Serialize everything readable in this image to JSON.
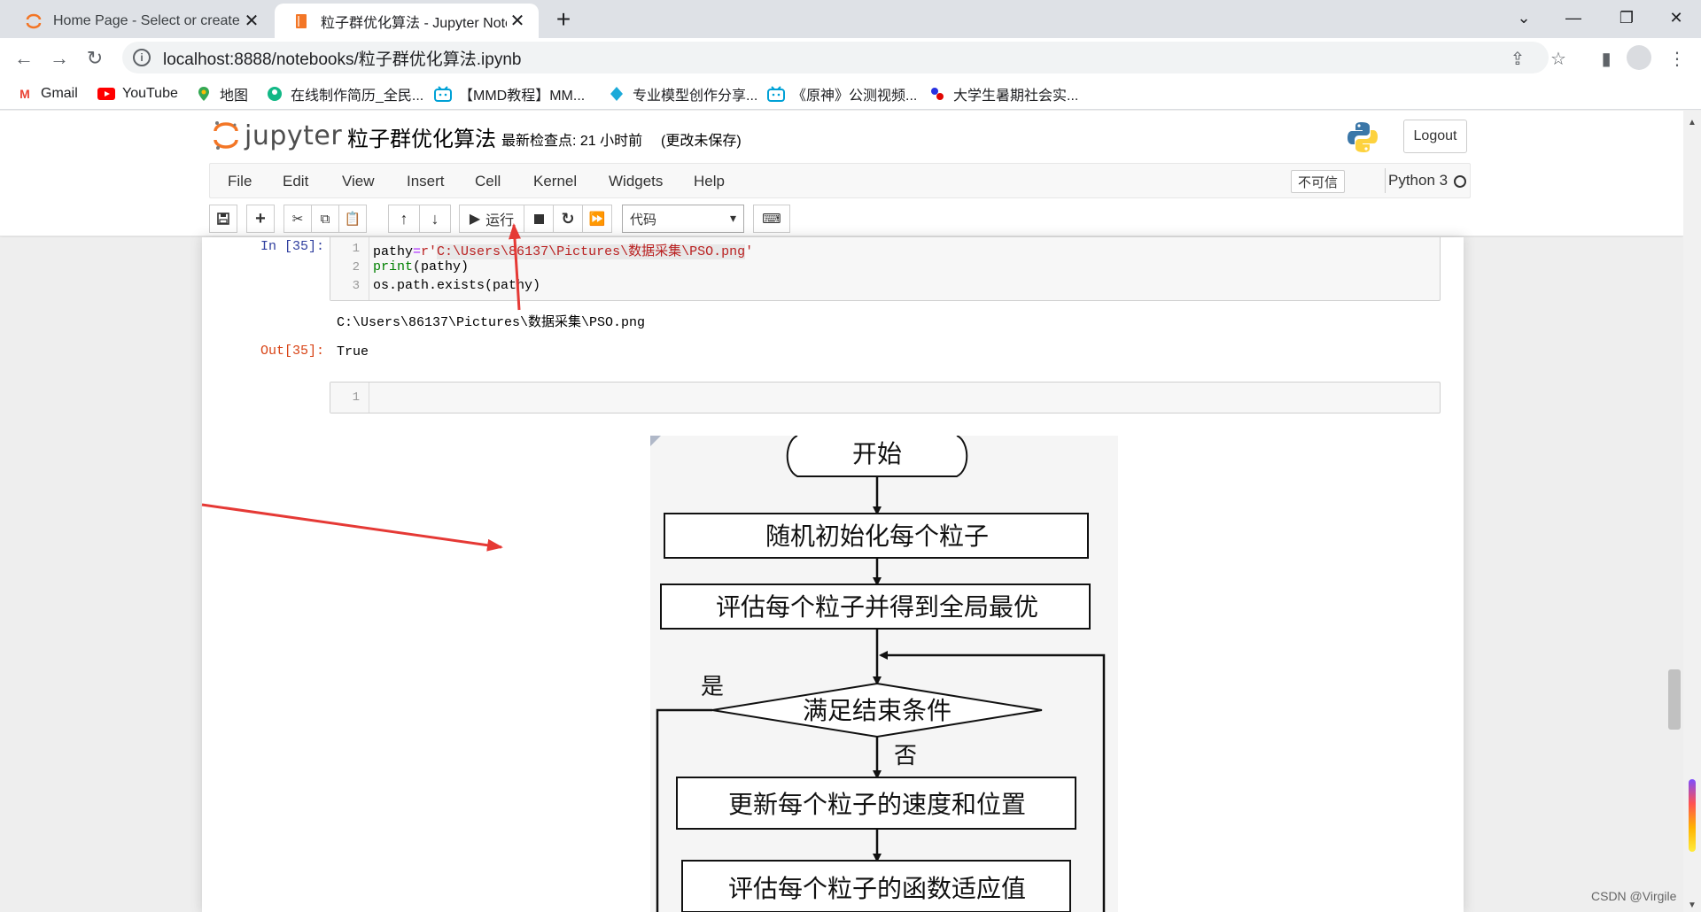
{
  "browser": {
    "tabs": [
      {
        "title": "Home Page - Select or create a notebook",
        "active": false
      },
      {
        "title": "粒子群优化算法 - Jupyter Notebook",
        "active": true
      }
    ],
    "url": "localhost:8888/notebooks/粒子群优化算法.ipynb",
    "bookmarks": [
      {
        "label": "Gmail",
        "icon": "gmail-icon"
      },
      {
        "label": "YouTube",
        "icon": "youtube-icon"
      },
      {
        "label": "地图",
        "icon": "maps-icon"
      },
      {
        "label": "在线制作简历_全民...",
        "icon": "resume-icon"
      },
      {
        "label": "【MMD教程】MM...",
        "icon": "bilibili-icon"
      },
      {
        "label": "专业模型创作分享...",
        "icon": "sketchfab-icon"
      },
      {
        "label": "《原神》公测视频...",
        "icon": "bilibili-icon"
      },
      {
        "label": "大学生暑期社会实...",
        "icon": "tieba-icon"
      }
    ]
  },
  "jupyter": {
    "logo_text": "jupyter",
    "notebook_title": "粒子群优化算法",
    "checkpoint": "最新检查点: 21 小时前",
    "unsaved": "(更改未保存)",
    "logout": "Logout",
    "menu": [
      "File",
      "Edit",
      "View",
      "Insert",
      "Cell",
      "Kernel",
      "Widgets",
      "Help"
    ],
    "trusted": "不可信",
    "kernel": "Python 3",
    "toolbar": {
      "run_label": "运行",
      "cell_type": "代码"
    }
  },
  "cells": {
    "cell1": {
      "prompt": "In  [35]:",
      "line_numbers": [
        "1",
        "2",
        "3"
      ],
      "line1_a": "pathy",
      "line1_op": "=",
      "line1_b": "r'",
      "line1_str": "C:\\Users\\86137\\Pictures\\数据采集\\PSO.png",
      "line1_end": "'",
      "line2_kw": "print",
      "line2_rest": "(pathy)",
      "line3": "os.path.exists(pathy)",
      "stdout": "C:\\Users\\86137\\Pictures\\数据采集\\PSO.png",
      "out_prompt": "Out[35]:",
      "out_value": "True"
    },
    "cell2": {
      "line_number": "1"
    }
  },
  "flowchart": {
    "start": "开始",
    "init": "随机初始化每个粒子",
    "evaluate_global": "评估每个粒子并得到全局最优",
    "condition": "满足结束条件",
    "yes": "是",
    "no": "否",
    "update": "更新每个粒子的速度和位置",
    "evaluate_fitness": "评估每个粒子的函数适应值"
  },
  "annotation_color": "#e53935",
  "watermark": "CSDN @Virgile"
}
